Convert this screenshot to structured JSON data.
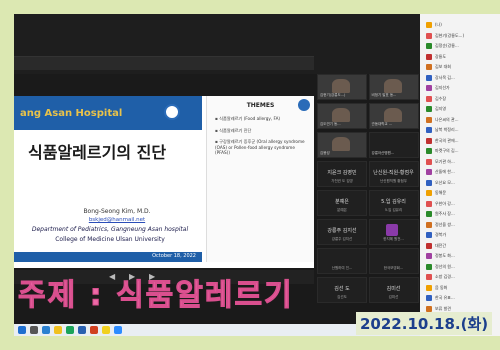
{
  "slide": {
    "hospital": "ang Asan Hospital",
    "title": "식품알레르기의 진단",
    "author": "Bong-Seong Kim, M.D.",
    "email": "bskjed@hanmail.net",
    "dept": "Department of Pediatrics, Gangneung Asan hospital",
    "college": "College of Medicine Ulsan University",
    "date": "October 18, 2022"
  },
  "themes": {
    "header": "THEMES",
    "items": [
      "식품알레르기 (Food allergy, FA)",
      "식품알레르기 진단",
      "구강알레르기 증후군 (Oral allergy syndrome (OAS) or Pollen-food allergy syndrome (PFAS))"
    ]
  },
  "tiles": [
    {
      "label": "김현기(강릉도...)",
      "dark": false,
      "person": true
    },
    {
      "label": "비정기 발표 동...",
      "dark": false,
      "person": true
    },
    {
      "label": "김도연기 동...",
      "dark": false,
      "person": true
    },
    {
      "label": "관동대학교 ...",
      "dark": false,
      "person": true
    },
    {
      "label": "김봉성",
      "dark": false,
      "person": true
    },
    {
      "label": "강릉아산병원...",
      "dark": true,
      "person": false
    },
    {
      "label": "",
      "name": "지윤크 김영민",
      "sub": "가천권 도 김영",
      "dark": true,
      "person": false
    },
    {
      "label": "",
      "name": "난신원-직원-황점우",
      "sub": "난신원직원 황점우",
      "dark": true,
      "person": false
    },
    {
      "label": "",
      "name": "분예은",
      "sub": "분예은",
      "dark": true,
      "person": false
    },
    {
      "label": "",
      "name": "5.입 김유리",
      "sub": "5.입 김유리",
      "dark": true,
      "person": false
    },
    {
      "label": "",
      "name": "강릉주 김지선",
      "sub": "강릉주 김지선",
      "dark": true,
      "person": false
    },
    {
      "label": "",
      "name": "",
      "sub": "한지혜 원전...",
      "dark": true,
      "avatar": true
    },
    {
      "label": "",
      "name": "",
      "sub": "산원하여 진...",
      "dark": true,
      "person": false
    },
    {
      "label": "",
      "name": "",
      "sub": "한국모영회...",
      "dark": true,
      "person": false
    },
    {
      "label": "",
      "name": "김선 도",
      "sub": "김선도",
      "dark": true,
      "person": false
    },
    {
      "label": "",
      "name": "김미선",
      "sub": "김미선",
      "dark": true,
      "person": false
    }
  ],
  "sidebar": {
    "items": [
      {
        "t": "(나)",
        "c": "#f0a000"
      },
      {
        "t": "김현기(강릉도...)",
        "c": "#e05050"
      },
      {
        "t": "김정순(강릉...",
        "c": "#2a8a2a"
      },
      {
        "t": "강릉도",
        "c": "#c03030"
      },
      {
        "t": "김보 대회",
        "c": "#d07020"
      },
      {
        "t": "강사목 김...",
        "c": "#3060c0"
      },
      {
        "t": "김지선가",
        "c": "#a040a0"
      },
      {
        "t": "김수장",
        "c": "#e05050"
      },
      {
        "t": "김지영",
        "c": "#2a8a2a"
      },
      {
        "t": "나은씨의 관...",
        "c": "#d07020"
      },
      {
        "t": "남북 박정리...",
        "c": "#3060c0"
      },
      {
        "t": "한국의 관에...",
        "c": "#c03030"
      },
      {
        "t": "마켓구의 김...",
        "c": "#2a8a2a"
      },
      {
        "t": "모기관 하...",
        "c": "#e05050"
      },
      {
        "t": "산돌에 한...",
        "c": "#a040a0"
      },
      {
        "t": "오산요 모...",
        "c": "#3060c0"
      },
      {
        "t": "동해문",
        "c": "#f0a000"
      },
      {
        "t": "우한아 강...",
        "c": "#e05050"
      },
      {
        "t": "원주사 장...",
        "c": "#2a8a2a"
      },
      {
        "t": "정선을 쌍...",
        "c": "#d07020"
      },
      {
        "t": "경북가",
        "c": "#3060c0"
      },
      {
        "t": "대전간",
        "c": "#c03030"
      },
      {
        "t": "정봉도 화...",
        "c": "#a040a0"
      },
      {
        "t": "정선의 원...",
        "c": "#2a8a2a"
      },
      {
        "t": "소방 김경...",
        "c": "#e05050"
      },
      {
        "t": "음 동화",
        "c": "#f0a000"
      },
      {
        "t": "한국 유표...",
        "c": "#3060c0"
      },
      {
        "t": "보류 발견",
        "c": "#d07020"
      },
      {
        "t": "보리주구리...",
        "c": "#c03030"
      }
    ]
  },
  "caption": "주제 : 식품알레르기",
  "date_badge": "2022.10.18.(화)"
}
